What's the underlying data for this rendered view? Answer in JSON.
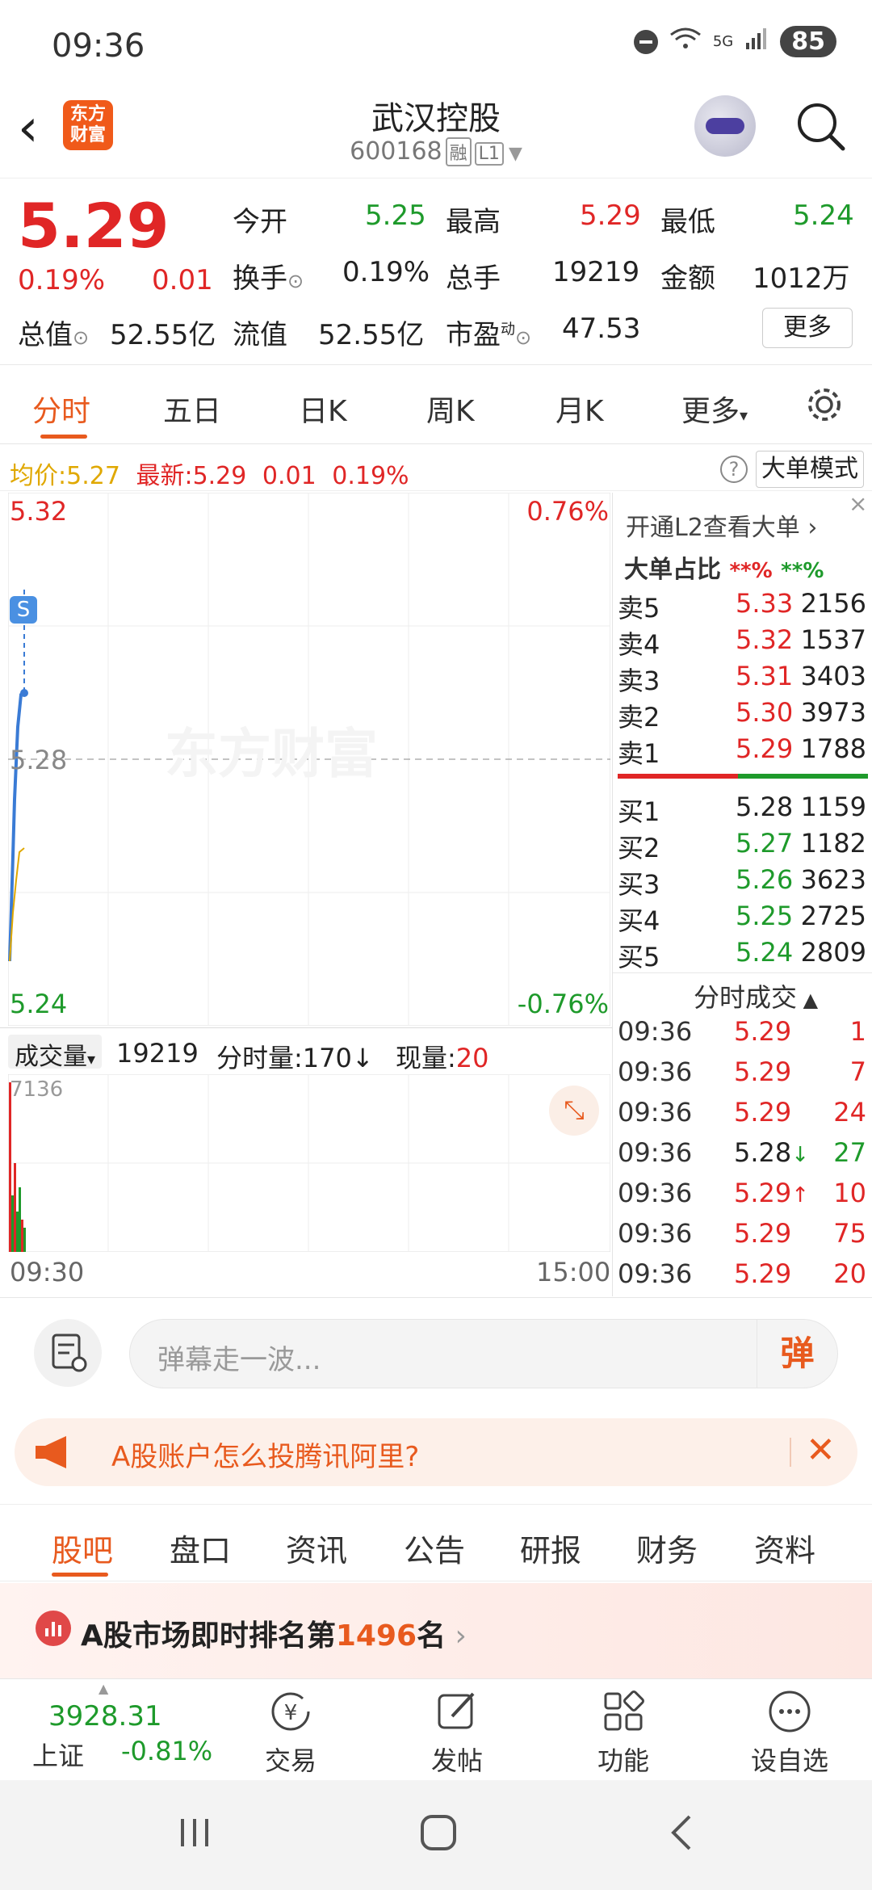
{
  "status": {
    "time": "09:36",
    "net": "5G",
    "battery": "85"
  },
  "header": {
    "logo": "东方财富",
    "title": "武汉控股",
    "code": "600168",
    "tag1": "融",
    "tag2": "L1"
  },
  "quote": {
    "price": "5.29",
    "pct": "0.19%",
    "chg": "0.01",
    "open_l": "今开",
    "open": "5.25",
    "high_l": "最高",
    "high": "5.29",
    "low_l": "最低",
    "low": "5.24",
    "turn_l": "换手",
    "turn": "0.19%",
    "vol_l": "总手",
    "vol": "19219",
    "amt_l": "金额",
    "amt": "1012万",
    "mcap_l": "总值",
    "mcap": "52.55亿",
    "fcap_l": "流值",
    "fcap": "52.55亿",
    "pe_l": "市盈",
    "pe_sup": "动",
    "pe": "47.53",
    "more": "更多"
  },
  "tabs": {
    "t1": "分时",
    "t2": "五日",
    "t3": "日K",
    "t4": "周K",
    "t5": "月K",
    "t6": "更多"
  },
  "avgline": {
    "avg_l": "均价:",
    "avg": "5.27",
    "new_l": "最新:",
    "new": "5.29",
    "chg": "0.01",
    "pct": "0.19%",
    "mode": "大单模式"
  },
  "chart": {
    "top_price": "5.32",
    "top_pct": "0.76%",
    "mid_price": "5.28",
    "bot_price": "5.24",
    "bot_pct": "-0.76%",
    "watermark": "东方财富",
    "marker": "S"
  },
  "vol": {
    "sel": "成交量",
    "total": "19219",
    "min_l": "分时量:",
    "min": "170",
    "cur_l": "现量:",
    "cur": "20",
    "max": "7136",
    "t_start": "09:30",
    "t_end": "15:00"
  },
  "panel": {
    "l2": "开通L2查看大单",
    "ratio": "大单占比",
    "r1": "**%",
    "r2": "**%",
    "asks": [
      {
        "n": "卖5",
        "p": "5.33",
        "v": "2156"
      },
      {
        "n": "卖4",
        "p": "5.32",
        "v": "1537"
      },
      {
        "n": "卖3",
        "p": "5.31",
        "v": "3403"
      },
      {
        "n": "卖2",
        "p": "5.30",
        "v": "3973"
      },
      {
        "n": "卖1",
        "p": "5.29",
        "v": "1788"
      }
    ],
    "bids": [
      {
        "n": "买1",
        "p": "5.28",
        "v": "1159"
      },
      {
        "n": "买2",
        "p": "5.27",
        "v": "1182"
      },
      {
        "n": "买3",
        "p": "5.26",
        "v": "3623"
      },
      {
        "n": "买4",
        "p": "5.25",
        "v": "2725"
      },
      {
        "n": "买5",
        "p": "5.24",
        "v": "2809"
      }
    ],
    "tick_hdr": "分时成交",
    "ticks": [
      {
        "t": "09:36",
        "p": "5.29",
        "v": "1"
      },
      {
        "t": "09:36",
        "p": "5.29",
        "v": "7"
      },
      {
        "t": "09:36",
        "p": "5.29",
        "v": "24"
      },
      {
        "t": "09:36",
        "p": "5.28",
        "v": "27"
      },
      {
        "t": "09:36",
        "p": "5.29",
        "v": "10"
      },
      {
        "t": "09:36",
        "p": "5.29",
        "v": "75"
      },
      {
        "t": "09:36",
        "p": "5.29",
        "v": "20"
      }
    ]
  },
  "danmu": {
    "placeholder": "弹幕走一波...",
    "send": "弹"
  },
  "ad": {
    "text": "A股账户怎么投腾讯阿里?"
  },
  "subtabs": {
    "s1": "股吧",
    "s2": "盘口",
    "s3": "资讯",
    "s4": "公告",
    "s5": "研报",
    "s6": "财务",
    "s7": "资料"
  },
  "rank": {
    "pre": "A股市场即时排名第",
    "num": "1496",
    "post": "名"
  },
  "bottom": {
    "idx_val": "3928.31",
    "idx_name": "上证",
    "idx_pct": "-0.81%",
    "n1": "交易",
    "n2": "发帖",
    "n3": "功能",
    "n4": "设自选"
  },
  "colors": {
    "up": "#e02626",
    "down": "#1e9a2b",
    "accent": "#e85a1e"
  }
}
